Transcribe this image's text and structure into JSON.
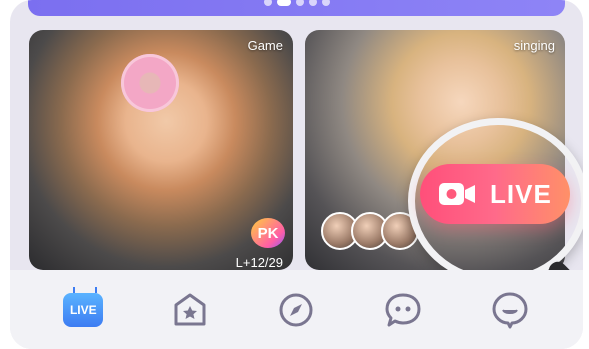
{
  "carousel": {
    "dots": 5,
    "active_index": 1
  },
  "cards": [
    {
      "tag": "Game",
      "badge": "PK",
      "viewer_count": "L+12/29"
    },
    {
      "tag": "singing"
    }
  ],
  "live_badge": {
    "label": "LIVE"
  },
  "tabs": [
    {
      "name": "live",
      "label": "LIVE",
      "icon": "tv-icon"
    },
    {
      "name": "home",
      "icon": "star-house-icon"
    },
    {
      "name": "explore",
      "icon": "compass-icon"
    },
    {
      "name": "chat",
      "icon": "chat-bubble-icon"
    },
    {
      "name": "profile",
      "icon": "profile-bubble-icon"
    }
  ],
  "colors": {
    "brand_purple": "#7b6ff0",
    "live_gradient_start": "#ff4f7a",
    "live_gradient_end": "#ff9068",
    "tab_active": "#3d7cf2",
    "icon_gray": "#7a7690"
  }
}
